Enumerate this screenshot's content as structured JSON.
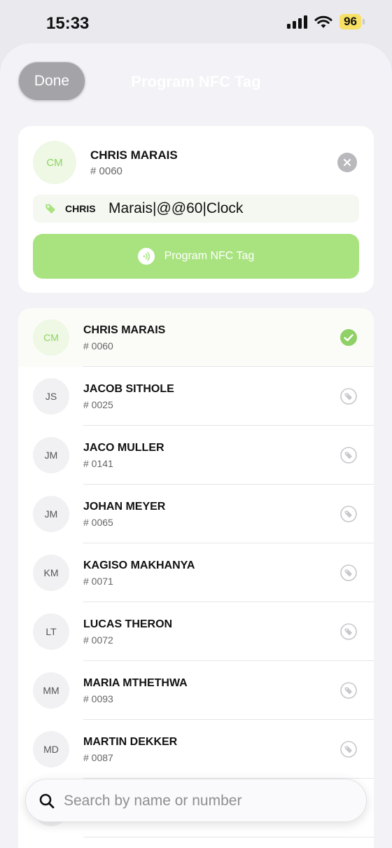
{
  "status_bar": {
    "time": "15:33",
    "battery": "96"
  },
  "header": {
    "done_label": "Done",
    "title": "Program NFC Tag"
  },
  "selected": {
    "initials": "CM",
    "name": "CHRIS MARAIS",
    "number": "# 0060",
    "tag_first": "CHRIS",
    "tag_value": "Marais|@@60|Clock",
    "program_label": "Program NFC Tag"
  },
  "employees": [
    {
      "initials": "CM",
      "name": "CHRIS MARAIS",
      "number": "# 0060",
      "state": "selected"
    },
    {
      "initials": "JS",
      "name": "JACOB SITHOLE",
      "number": "# 0025",
      "state": "tag"
    },
    {
      "initials": "JM",
      "name": "JACO MULLER",
      "number": "# 0141",
      "state": "tag"
    },
    {
      "initials": "JM",
      "name": "JOHAN MEYER",
      "number": "# 0065",
      "state": "tag"
    },
    {
      "initials": "KM",
      "name": "KAGISO MAKHANYA",
      "number": "# 0071",
      "state": "tag"
    },
    {
      "initials": "LT",
      "name": "LUCAS THERON",
      "number": "# 0072",
      "state": "tag"
    },
    {
      "initials": "MM",
      "name": "MARIA MTHETHWA",
      "number": "# 0093",
      "state": "tag"
    },
    {
      "initials": "MD",
      "name": "MARTIN DEKKER",
      "number": "# 0087",
      "state": "tag"
    }
  ],
  "search": {
    "placeholder": "Search by name or number"
  },
  "colors": {
    "accent_green": "#a9e380",
    "check_green": "#8fd166",
    "sheet_bg": "#f2f2f7"
  }
}
